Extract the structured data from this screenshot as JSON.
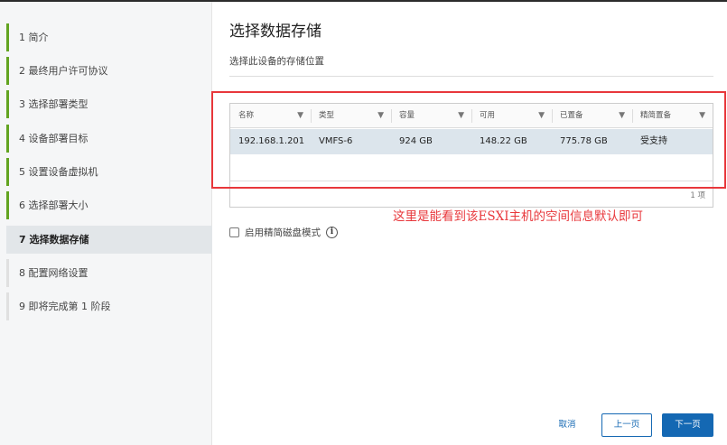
{
  "sidebar": {
    "steps": [
      {
        "label": "1  简介",
        "state": "done"
      },
      {
        "label": "2  最终用户许可协议",
        "state": "done"
      },
      {
        "label": "3  选择部署类型",
        "state": "done"
      },
      {
        "label": "4  设备部署目标",
        "state": "done"
      },
      {
        "label": "5  设置设备虚拟机",
        "state": "done"
      },
      {
        "label": "6  选择部署大小",
        "state": "done"
      },
      {
        "label": "7  选择数据存储",
        "state": "active"
      },
      {
        "label": "8  配置网络设置",
        "state": "pending"
      },
      {
        "label": "9  即将完成第 1 阶段",
        "state": "pending"
      }
    ]
  },
  "main": {
    "title": "选择数据存储",
    "subtitle": "选择此设备的存储位置",
    "grid": {
      "columns": [
        "名称",
        "类型",
        "容量",
        "可用",
        "已置备",
        "精简置备"
      ],
      "filter_icon": "filter-icon",
      "rows": [
        [
          "192.168.1.201",
          "VMFS-6",
          "924 GB",
          "148.22 GB",
          "775.78 GB",
          "受支持"
        ]
      ],
      "count": "1 项"
    },
    "thin_disk": {
      "label": "启用精简磁盘模式",
      "checked": false,
      "info_glyph": "i"
    }
  },
  "annotation": {
    "text": "这里是能看到该ESXI主机的空间信息默认即可",
    "color": "#e8373b"
  },
  "footer": {
    "cancel": "取消",
    "back": "上一页",
    "next": "下一页"
  },
  "colors": {
    "accent": "#1468b3",
    "done_step": "#62a420",
    "selected_row": "#dce5ec"
  }
}
